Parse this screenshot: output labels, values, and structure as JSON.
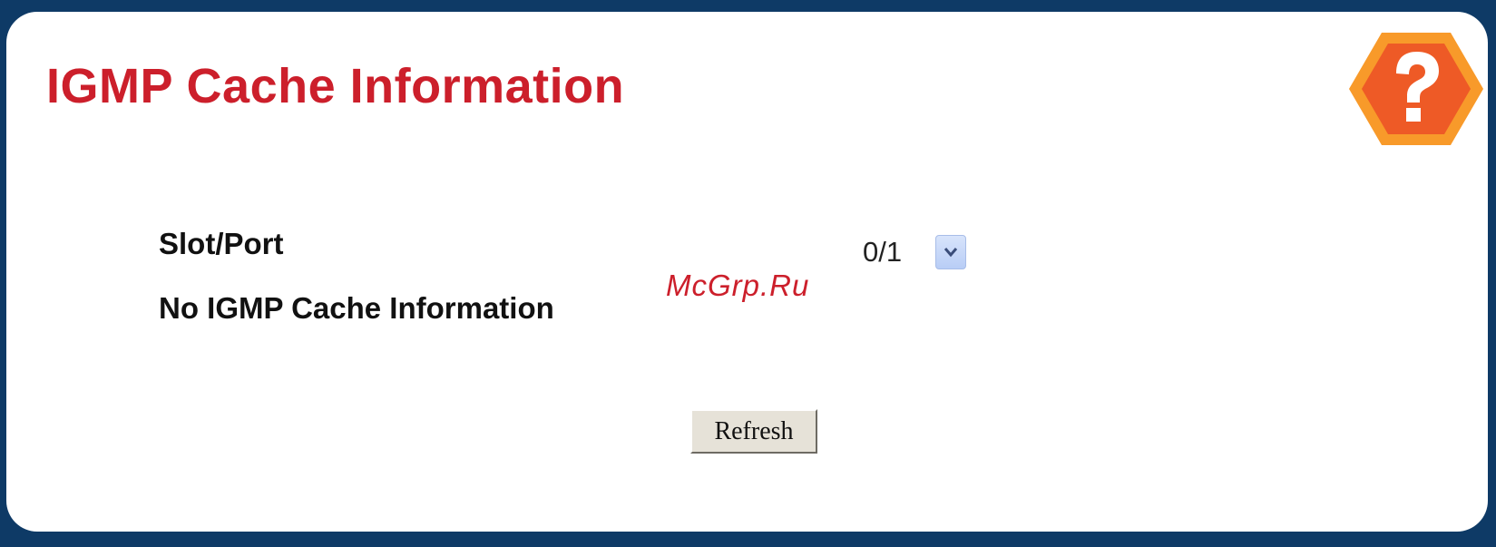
{
  "page": {
    "title": "IGMP Cache Information"
  },
  "form": {
    "slot_port_label": "Slot/Port",
    "slot_port_value": "0/1",
    "status_message": "No IGMP Cache Information"
  },
  "watermark": "McGrp.Ru",
  "actions": {
    "refresh_label": "Refresh"
  },
  "icons": {
    "help": "help-question-icon",
    "dropdown": "chevron-down-icon"
  },
  "colors": {
    "frame": "#0e3a66",
    "title": "#cc1f2b",
    "help_outer": "#f89a2a",
    "help_inner": "#ee5a26"
  }
}
